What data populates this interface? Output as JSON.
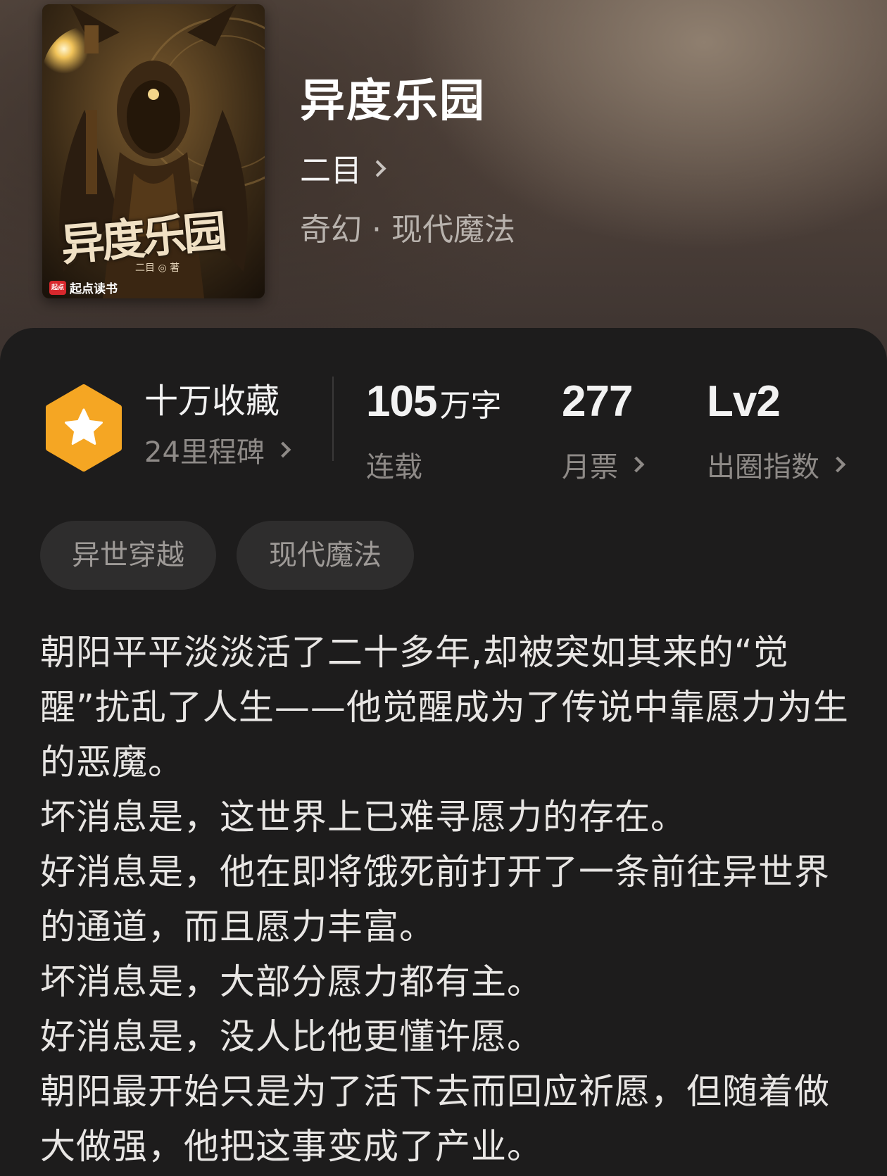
{
  "cover": {
    "title_text": "异度乐园",
    "author_text": "二目 ◎ 著",
    "brand_logo": "起点",
    "brand_text": "起点读书"
  },
  "book": {
    "title": "异度乐园",
    "author": "二目",
    "genre": "奇幻 · 现代魔法"
  },
  "stats": {
    "collection": {
      "title": "十万收藏",
      "subtitle": "24里程碑",
      "badge_color": "#F5A623",
      "icon": "star-icon"
    },
    "words": {
      "number": "105",
      "unit": "万字",
      "label": "连载"
    },
    "monthly_votes": {
      "number": "277",
      "label": "月票"
    },
    "breakout": {
      "number": "Lv2",
      "label": "出圈指数"
    }
  },
  "tags": [
    "异世穿越",
    "现代魔法"
  ],
  "synopsis": [
    "朝阳平平淡淡活了二十多年,却被突如其来的“觉醒”扰乱了人生——他觉醒成为了传说中靠愿力为生的恶魔。",
    "坏消息是，这世界上已难寻愿力的存在。",
    "好消息是，他在即将饿死前打开了一条前往异世界的通道，而且愿力丰富。",
    "坏消息是，大部分愿力都有主。",
    "好消息是，没人比他更懂许愿。",
    "朝阳最开始只是为了活下去而回应祈愿，但随着做大做强，他把这事变成了产业。"
  ]
}
